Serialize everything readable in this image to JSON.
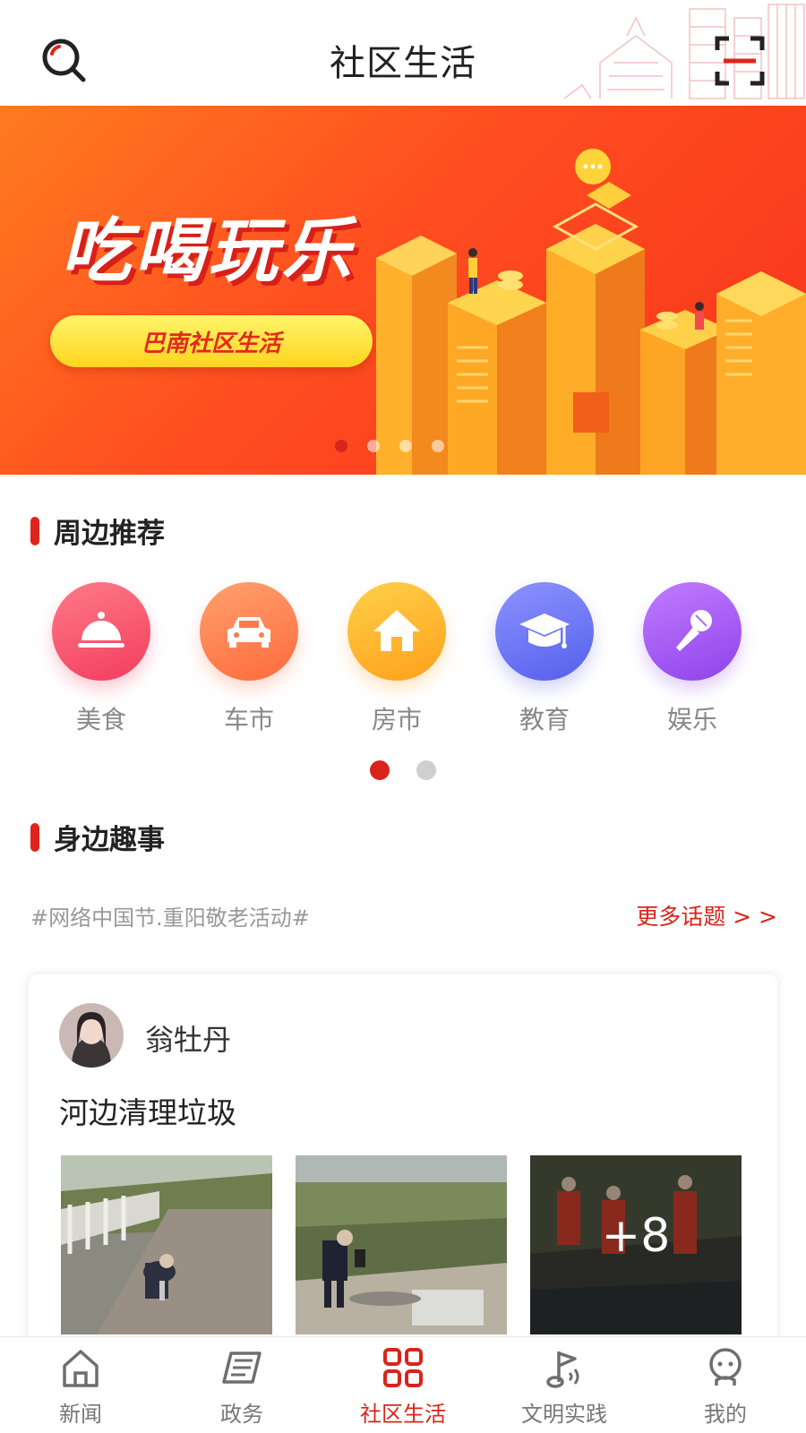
{
  "header": {
    "title": "社区生活"
  },
  "banner": {
    "headline": "吃喝玩乐",
    "pill_label": "巴南社区生活",
    "slide_count": 4,
    "active_slide": 1
  },
  "nearby": {
    "title": "周边推荐",
    "items": [
      {
        "label": "美食",
        "icon": "food-cloche-icon",
        "color": "#f5516a"
      },
      {
        "label": "车市",
        "icon": "car-icon",
        "color": "#ff7c4e"
      },
      {
        "label": "房市",
        "icon": "house-icon",
        "color": "#ffb21e"
      },
      {
        "label": "教育",
        "icon": "graduation-cap-icon",
        "color": "#6b74f2"
      },
      {
        "label": "娱乐",
        "icon": "microphone-icon",
        "color": "#a55af3"
      }
    ],
    "page_count": 2,
    "active_page": 1
  },
  "fun": {
    "title": "身边趣事",
    "topic": "#网络中国节.重阳敬老活动#",
    "more_label": "更多话题 > >",
    "post": {
      "username": "翁牡丹",
      "title": "河边清理垃圾",
      "extra_count": "+8"
    }
  },
  "tabbar": {
    "items": [
      {
        "label": "新闻",
        "icon": "home-icon"
      },
      {
        "label": "政务",
        "icon": "newspaper-icon"
      },
      {
        "label": "社区生活",
        "icon": "grid-icon"
      },
      {
        "label": "文明实践",
        "icon": "flag-icon"
      },
      {
        "label": "我的",
        "icon": "profile-icon"
      }
    ],
    "active_index": 2
  },
  "colors": {
    "accent": "#d9241b",
    "banner_start": "#ff7a1f",
    "banner_end": "#f7341c",
    "pill": "#ffe02a"
  }
}
